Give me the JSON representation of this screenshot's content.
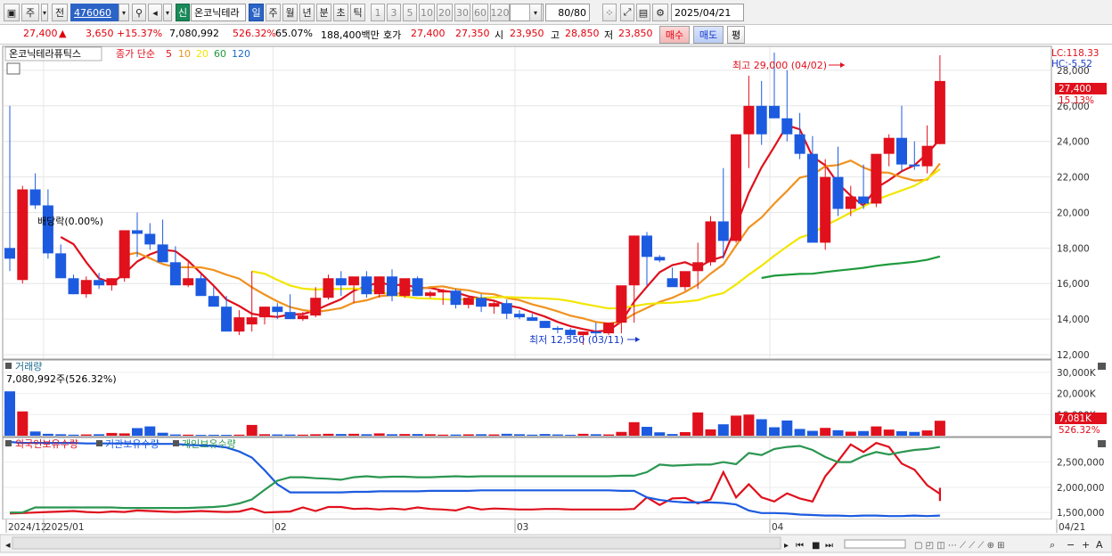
{
  "toolbar": {
    "market": "주",
    "prev": "전",
    "code": "476060",
    "new_badge": "신",
    "name": "온코닉테라",
    "periods": [
      "일",
      "주",
      "월",
      "년",
      "분",
      "초",
      "틱"
    ],
    "active_period": "일",
    "minutes": [
      "1",
      "3",
      "5",
      "10",
      "20",
      "30",
      "60",
      "120"
    ],
    "count": "80",
    "count_total": "/80",
    "date": "2025/04/21"
  },
  "quote": {
    "price": "27,400",
    "arrow": "▲",
    "change": "3,650",
    "change_pct": "+15.37%",
    "volume": "7,080,992",
    "volume_ratio": "526.32%",
    "turnover": "65.07%",
    "amount": "188,400백만",
    "hoga_label": "호가",
    "ask": "27,400",
    "bid": "27,350",
    "open_label": "시",
    "open": "23,950",
    "high_label": "고",
    "high": "28,850",
    "low_label": "저",
    "low": "23,850",
    "buy_label": "매수",
    "sell_label": "매도",
    "avg_label": "평"
  },
  "price_panel": {
    "stock_label": "온코닉테라퓨틱스",
    "ma_prefix": "종가 단순",
    "ma": [
      {
        "period": "5",
        "color": "#e0101c"
      },
      {
        "period": "10",
        "color": "#f0921e"
      },
      {
        "period": "20",
        "color": "#f2e600"
      },
      {
        "period": "60",
        "color": "#1e9a3c"
      },
      {
        "period": "120",
        "color": "#1c69c9"
      }
    ],
    "lc": "LC:118.33",
    "hc": "HC:-5.52",
    "current_tag": "27,400",
    "current_pct": "15.13%",
    "high_annotation": "최고 29,000 (04/02)",
    "low_annotation": "최저 12,550 (03/11)",
    "ex_annotation": "배당락(0.00%)",
    "y_ticks": [
      "28,000",
      "26,000",
      "24,000",
      "22,000",
      "20,000",
      "18,000",
      "16,000",
      "14,000",
      "12,000"
    ]
  },
  "volume_panel": {
    "title": "거래량",
    "info": "7,080,992주(526.32%)",
    "y_ticks": [
      "30,000K",
      "20,000K",
      "10,000K"
    ],
    "current_tag": "7,081K",
    "current_pct": "526.32%"
  },
  "holding_panel": {
    "legend": [
      "외국인보유수량",
      "기관보유수량",
      "개인보유수량"
    ],
    "legend_colors": [
      "#e0101c",
      "#1c5be0",
      "#2a9650"
    ],
    "y_ticks": [
      "2,500,000",
      "2,000,000",
      "1,500,000"
    ]
  },
  "xaxis": [
    "2024/12",
    "2025/01",
    "02",
    "03",
    "04",
    "04/21"
  ],
  "chart_data": [
    {
      "type": "candlestick",
      "title": "온코닉테라퓨틱스",
      "x_dates": [
        "2024/12/27",
        "2024/12/30",
        "2025/01/02",
        "2025/01/03",
        "2025/01/06",
        "2025/01/07",
        "2025/01/08",
        "2025/01/09",
        "2025/01/10",
        "2025/01/13",
        "2025/01/14",
        "2025/01/15",
        "2025/01/16",
        "2025/01/17",
        "2025/01/20",
        "2025/01/21",
        "2025/01/22",
        "2025/01/23",
        "2025/01/24",
        "2025/01/31",
        "2025/02/03",
        "2025/02/04",
        "2025/02/05",
        "2025/02/06",
        "2025/02/07",
        "2025/02/10",
        "2025/02/11",
        "2025/02/12",
        "2025/02/13",
        "2025/02/14",
        "2025/02/17",
        "2025/02/18",
        "2025/02/19",
        "2025/02/20",
        "2025/02/21",
        "2025/02/24",
        "2025/02/25",
        "2025/02/26",
        "2025/02/27",
        "2025/02/28",
        "2025/03/04",
        "2025/03/05",
        "2025/03/06",
        "2025/03/07",
        "2025/03/10",
        "2025/03/11",
        "2025/03/12",
        "2025/03/13",
        "2025/03/14",
        "2025/03/17",
        "2025/03/18",
        "2025/03/19",
        "2025/03/20",
        "2025/03/21",
        "2025/03/24",
        "2025/03/25",
        "2025/03/26",
        "2025/03/27",
        "2025/03/28",
        "2025/03/31",
        "2025/04/01",
        "2025/04/02",
        "2025/04/03",
        "2025/04/04",
        "2025/04/07",
        "2025/04/08",
        "2025/04/09",
        "2025/04/10",
        "2025/04/11",
        "2025/04/14",
        "2025/04/15",
        "2025/04/16",
        "2025/04/17",
        "2025/04/18",
        "2025/04/21"
      ],
      "open": [
        18000,
        16200,
        21300,
        20400,
        17700,
        16300,
        15400,
        16200,
        15900,
        16300,
        19000,
        18800,
        18200,
        17200,
        15900,
        16300,
        15300,
        14700,
        13300,
        13700,
        14100,
        14700,
        14400,
        14000,
        14200,
        15200,
        16300,
        15900,
        16400,
        15400,
        16400,
        15300,
        16300,
        15300,
        15500,
        15600,
        14800,
        15200,
        14700,
        14900,
        14300,
        14100,
        13900,
        13500,
        13400,
        13100,
        13300,
        13200,
        13800,
        15900,
        18700,
        17500,
        16300,
        15800,
        16700,
        17200,
        19500,
        18400,
        24400,
        26000,
        26000,
        25300,
        24400,
        23300,
        18300,
        22000,
        20200,
        20900,
        20500,
        23300,
        24200,
        22700,
        22600,
        23850
      ],
      "high": [
        26000,
        21500,
        22200,
        21300,
        18200,
        16500,
        16400,
        16600,
        16300,
        17300,
        20000,
        19400,
        19600,
        18100,
        17200,
        16500,
        15800,
        15300,
        14500,
        16700,
        14700,
        14900,
        15400,
        14400,
        15800,
        16500,
        16700,
        16200,
        16700,
        16400,
        16800,
        16000,
        16400,
        15600,
        15700,
        15700,
        15300,
        15400,
        15000,
        15100,
        14500,
        14300,
        13900,
        13600,
        13500,
        13300,
        13800,
        13300,
        14500,
        18700,
        18900,
        17600,
        16900,
        16600,
        18300,
        19800,
        22500,
        19700,
        27700,
        27400,
        29000,
        28000,
        25600,
        24300,
        23000,
        23700,
        21500,
        22700,
        21800,
        24400,
        26000,
        24000,
        24900,
        28850
      ],
      "low": [
        16700,
        16000,
        20200,
        17400,
        16500,
        15400,
        15200,
        15700,
        15600,
        16100,
        17500,
        17900,
        18000,
        16900,
        15800,
        15700,
        14900,
        13300,
        13100,
        13300,
        13700,
        14000,
        14100,
        13900,
        14100,
        15100,
        15300,
        14900,
        15200,
        15200,
        15000,
        15200,
        15300,
        15200,
        14800,
        14600,
        14600,
        14400,
        14300,
        14000,
        14000,
        13900,
        13600,
        13200,
        12900,
        12550,
        13000,
        13100,
        13200,
        13800,
        15900,
        17200,
        16000,
        15600,
        15700,
        17000,
        17400,
        18300,
        22500,
        23800,
        25500,
        24000,
        23000,
        22500,
        17900,
        19800,
        19800,
        20200,
        20300,
        22600,
        22300,
        22400,
        22200,
        23850
      ],
      "close": [
        17400,
        21300,
        20400,
        17700,
        16300,
        15400,
        16200,
        15900,
        16300,
        19000,
        18800,
        18200,
        17200,
        15900,
        16300,
        15300,
        14700,
        13300,
        14100,
        14100,
        14700,
        14400,
        14000,
        14200,
        15200,
        16300,
        15900,
        16400,
        15400,
        16400,
        15300,
        16300,
        15300,
        15500,
        15600,
        14800,
        15200,
        14700,
        14900,
        14300,
        14100,
        13900,
        13500,
        13400,
        13100,
        13300,
        13200,
        13800,
        15900,
        18700,
        17500,
        17300,
        15800,
        16700,
        17200,
        19500,
        18400,
        24400,
        26000,
        24400,
        25300,
        24400,
        23300,
        18300,
        22000,
        20200,
        20900,
        20500,
        23300,
        24200,
        22700,
        22600,
        23750,
        27400
      ],
      "volume": [
        21000,
        11500,
        2000,
        900,
        700,
        500,
        600,
        700,
        1300,
        1100,
        3600,
        4400,
        1400,
        600,
        500,
        400,
        450,
        420,
        500,
        5100,
        700,
        600,
        550,
        500,
        700,
        900,
        800,
        900,
        700,
        1100,
        700,
        800,
        800,
        700,
        500,
        550,
        650,
        700,
        600,
        900,
        700,
        500,
        800,
        600,
        450,
        900,
        700,
        600,
        1800,
        6400,
        4200,
        1600,
        800,
        1700,
        11000,
        3000,
        5400,
        9500,
        10000,
        7800,
        4000,
        7200,
        3200,
        2300,
        3700,
        2600,
        1900,
        2200,
        4400,
        2900,
        2100,
        1800,
        2500,
        7081
      ],
      "y_ticks": [
        12000,
        14000,
        16000,
        18000,
        20000,
        22000,
        24000,
        26000,
        28000
      ],
      "ylim": [
        11800,
        29300
      ],
      "volume_ylim": [
        0,
        35000
      ],
      "volume_unit": "K"
    },
    {
      "type": "line",
      "title": "",
      "series": [
        {
          "name": "외국인보유수량",
          "values": [
            1480000,
            1490000,
            1500000,
            1510000,
            1520000,
            1530000,
            1510000,
            1500000,
            1520000,
            1510000,
            1540000,
            1530000,
            1520000,
            1510000,
            1520000,
            1530000,
            1520000,
            1510000,
            1520000,
            1580000,
            1500000,
            1510000,
            1520000,
            1600000,
            1530000,
            1610000,
            1610000,
            1570000,
            1580000,
            1560000,
            1580000,
            1560000,
            1600000,
            1570000,
            1560000,
            1540000,
            1610000,
            1560000,
            1580000,
            1570000,
            1560000,
            1560000,
            1570000,
            1570000,
            1560000,
            1560000,
            1560000,
            1560000,
            1560000,
            1570000,
            1800000,
            1650000,
            1780000,
            1790000,
            1680000,
            1760000,
            2300000,
            1800000,
            2060000,
            1800000,
            1720000,
            1880000,
            1780000,
            1720000,
            2220000,
            2520000,
            2850000,
            2700000,
            2880000,
            2800000,
            2470000,
            2350000,
            2040000,
            1870000,
            1990000,
            1870000,
            1730000,
            1730000
          ],
          "color": "#e0101c"
        },
        {
          "name": "기관보유수량",
          "values": [
            2900000,
            2880000,
            2880000,
            2880000,
            2880000,
            2880000,
            2870000,
            2870000,
            2870000,
            2870000,
            2860000,
            2860000,
            2860000,
            2860000,
            2840000,
            2830000,
            2820000,
            2790000,
            2710000,
            2590000,
            2340000,
            2060000,
            1900000,
            1900000,
            1900000,
            1900000,
            1900000,
            1910000,
            1910000,
            1920000,
            1920000,
            1920000,
            1920000,
            1930000,
            1930000,
            1930000,
            1930000,
            1940000,
            1940000,
            1940000,
            1940000,
            1940000,
            1940000,
            1940000,
            1940000,
            1940000,
            1940000,
            1940000,
            1930000,
            1930000,
            1800000,
            1750000,
            1720000,
            1700000,
            1700000,
            1700000,
            1690000,
            1660000,
            1540000,
            1490000,
            1490000,
            1480000,
            1460000,
            1450000,
            1440000,
            1440000,
            1430000,
            1440000,
            1440000,
            1430000,
            1430000,
            1440000,
            1430000,
            1440000
          ],
          "color": "#1c5be0"
        },
        {
          "name": "개인보유수량",
          "values": [
            1500000,
            1500000,
            1600000,
            1600000,
            1600000,
            1600000,
            1600000,
            1600000,
            1600000,
            1590000,
            1590000,
            1590000,
            1590000,
            1590000,
            1590000,
            1600000,
            1610000,
            1630000,
            1680000,
            1760000,
            1950000,
            2130000,
            2200000,
            2200000,
            2180000,
            2170000,
            2150000,
            2200000,
            2220000,
            2200000,
            2210000,
            2210000,
            2200000,
            2200000,
            2210000,
            2220000,
            2210000,
            2220000,
            2220000,
            2220000,
            2220000,
            2220000,
            2220000,
            2220000,
            2220000,
            2220000,
            2220000,
            2220000,
            2230000,
            2230000,
            2300000,
            2450000,
            2430000,
            2440000,
            2450000,
            2450000,
            2500000,
            2460000,
            2680000,
            2640000,
            2760000,
            2800000,
            2820000,
            2740000,
            2600000,
            2500000,
            2500000,
            2620000,
            2700000,
            2650000,
            2700000,
            2740000,
            2760000,
            2800000
          ],
          "color": "#2a9650"
        }
      ],
      "y_ticks": [
        1500000,
        2000000,
        2500000
      ],
      "ylim": [
        1380000,
        2970000
      ]
    }
  ]
}
